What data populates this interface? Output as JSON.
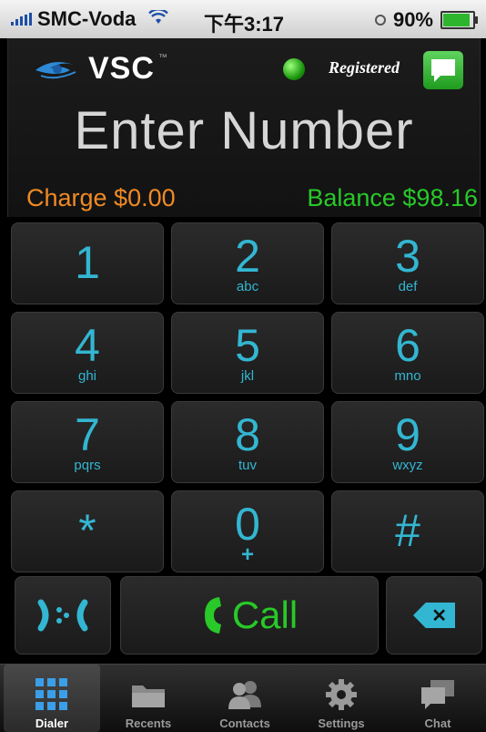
{
  "status_bar": {
    "carrier": "SMC-Voda",
    "time": "下午3:17",
    "battery": "90%",
    "battery_level": 0.9
  },
  "header": {
    "logo_text": "VSC",
    "registration_status": "Registered",
    "display_text": "Enter Number",
    "charge": "Charge $0.00",
    "balance": "Balance $98.16",
    "colors": {
      "charge": "#f08a26",
      "balance": "#28c928",
      "keys": "#33b6d1"
    }
  },
  "keypad": {
    "keys": [
      {
        "digit": "1",
        "letters": ""
      },
      {
        "digit": "2",
        "letters": "abc"
      },
      {
        "digit": "3",
        "letters": "def"
      },
      {
        "digit": "4",
        "letters": "ghi"
      },
      {
        "digit": "5",
        "letters": "jkl"
      },
      {
        "digit": "6",
        "letters": "mno"
      },
      {
        "digit": "7",
        "letters": "pqrs"
      },
      {
        "digit": "8",
        "letters": "tuv"
      },
      {
        "digit": "9",
        "letters": "wxyz"
      },
      {
        "digit": "*",
        "letters": ""
      },
      {
        "digit": "0",
        "letters": "+"
      },
      {
        "digit": "#",
        "letters": ""
      }
    ]
  },
  "actions": {
    "transfer_icon": "transfer-icon",
    "call_label": "Call",
    "call_icon": "phone-handset-icon",
    "delete_icon": "backspace-icon"
  },
  "tab_bar": {
    "tabs": [
      {
        "label": "Dialer",
        "icon": "keypad-grid-icon",
        "active": true
      },
      {
        "label": "Recents",
        "icon": "folder-icon",
        "active": false
      },
      {
        "label": "Contacts",
        "icon": "people-icon",
        "active": false
      },
      {
        "label": "Settings",
        "icon": "gear-icon",
        "active": false
      },
      {
        "label": "Chat",
        "icon": "chat-bubbles-icon",
        "active": false
      }
    ]
  }
}
